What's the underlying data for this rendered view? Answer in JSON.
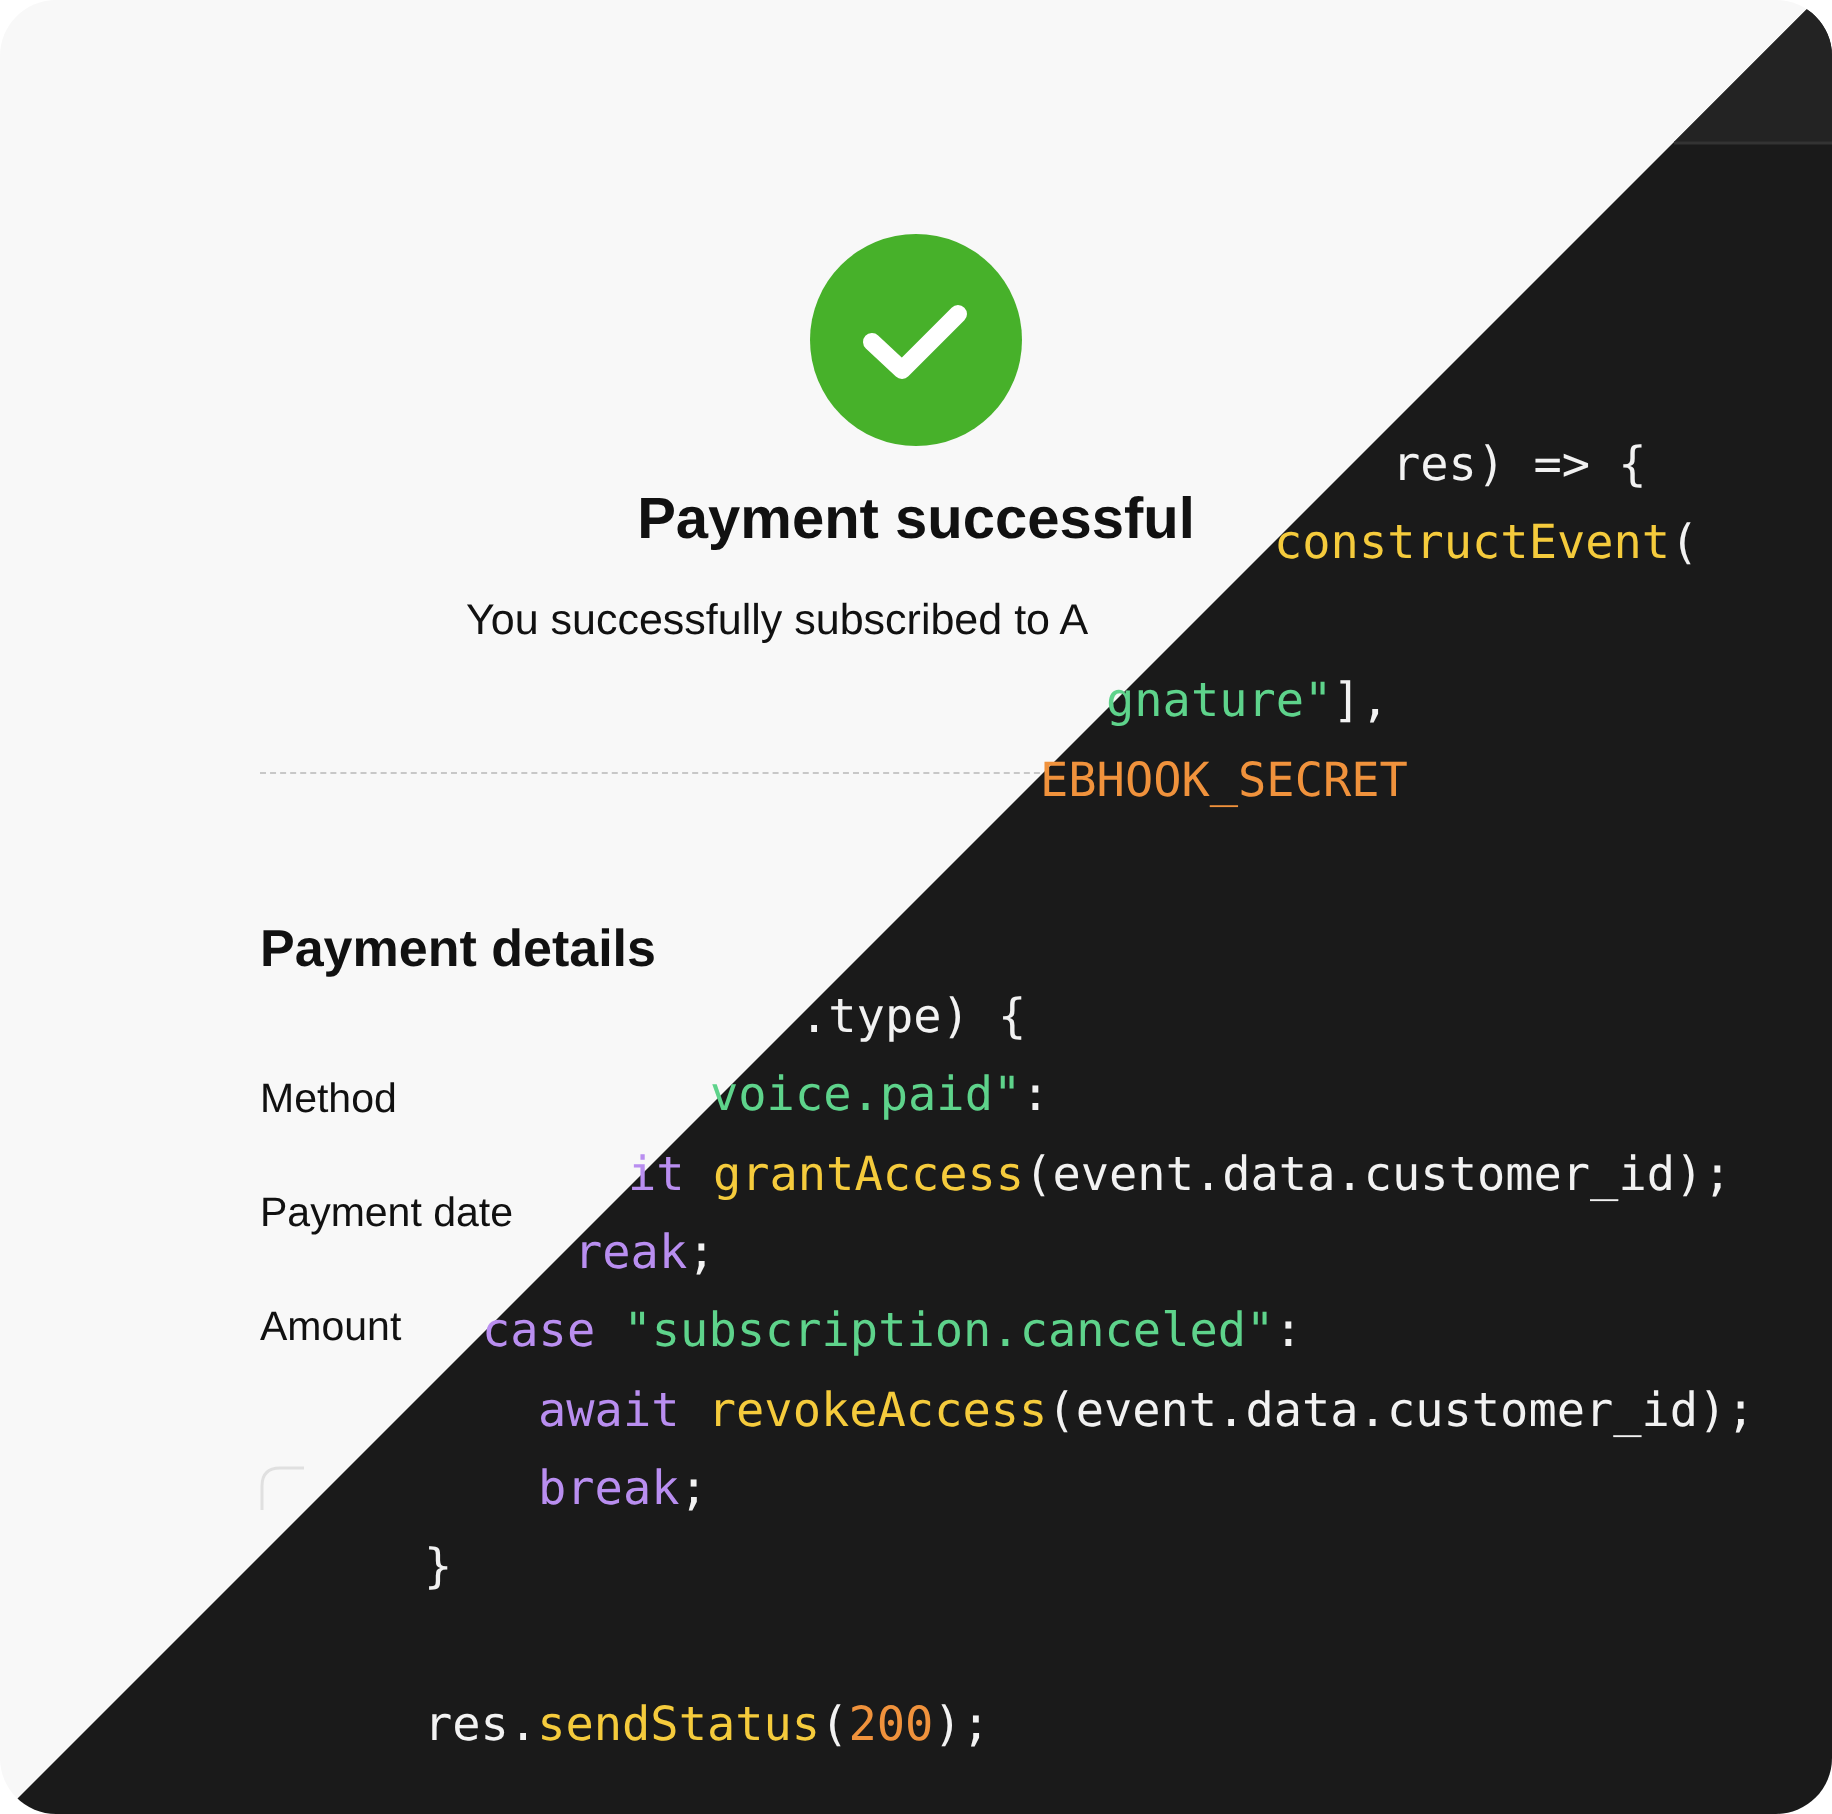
{
  "success": {
    "title": "Payment successful",
    "message": "You successfully subscribed to A"
  },
  "details": {
    "heading": "Payment details",
    "labels": [
      "Method",
      "Payment date",
      "Amount"
    ]
  },
  "code": [
    {
      "tokens": [
        {
          "text": "res) => {",
          "kind": "plain"
        }
      ]
    },
    {
      "tokens": [
        {
          "text": "constructEvent",
          "kind": "func"
        },
        {
          "text": "(",
          "kind": "plain"
        }
      ]
    },
    {
      "tokens": [
        {
          "text": "gnature\"",
          "kind": "string"
        },
        {
          "text": "],",
          "kind": "plain"
        }
      ]
    },
    {
      "tokens": [
        {
          "text": "EBHOOK_SECRET",
          "kind": "constant"
        }
      ]
    },
    {
      "tokens": [
        {
          "text": ".type) {",
          "kind": "plain"
        }
      ]
    },
    {
      "tokens": [
        {
          "text": "voice.paid\"",
          "kind": "string"
        },
        {
          "text": ":",
          "kind": "plain"
        }
      ]
    },
    {
      "tokens": [
        {
          "text": "it ",
          "kind": "keyword"
        },
        {
          "text": "grantAccess",
          "kind": "func"
        },
        {
          "text": "(event.data.customer_id);",
          "kind": "plain"
        }
      ]
    },
    {
      "tokens": [
        {
          "text": "reak",
          "kind": "keyword"
        },
        {
          "text": ";",
          "kind": "plain"
        }
      ]
    },
    {
      "tokens": [
        {
          "text": "case ",
          "kind": "keyword"
        },
        {
          "text": "\"subscription.canceled\"",
          "kind": "string"
        },
        {
          "text": ":",
          "kind": "plain"
        }
      ]
    },
    {
      "tokens": [
        {
          "text": "await ",
          "kind": "keyword"
        },
        {
          "text": "revokeAccess",
          "kind": "func"
        },
        {
          "text": "(event.data.customer_id);",
          "kind": "plain"
        }
      ]
    },
    {
      "tokens": [
        {
          "text": "break",
          "kind": "keyword"
        },
        {
          "text": ";",
          "kind": "plain"
        }
      ]
    },
    {
      "tokens": [
        {
          "text": "}",
          "kind": "plain"
        }
      ]
    },
    {
      "tokens": [
        {
          "text": "res.",
          "kind": "plain"
        },
        {
          "text": "sendStatus",
          "kind": "func"
        },
        {
          "text": "(",
          "kind": "plain"
        },
        {
          "text": "200",
          "kind": "number"
        },
        {
          "text": ");",
          "kind": "plain"
        }
      ]
    }
  ]
}
